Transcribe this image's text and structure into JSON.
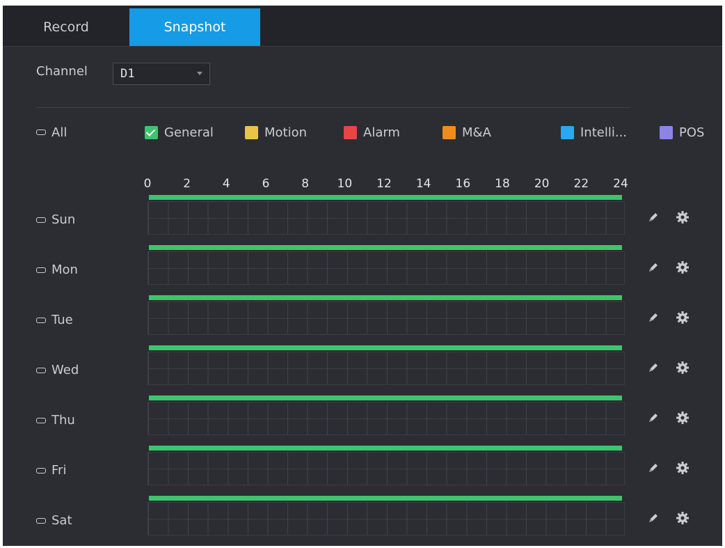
{
  "tabs": [
    {
      "label": "Record",
      "active": false
    },
    {
      "label": "Snapshot",
      "active": true
    }
  ],
  "channel": {
    "label": "Channel",
    "value": "D1"
  },
  "all_label": "All",
  "legend": [
    {
      "label": "General",
      "color": "#3ec46d",
      "checked": true
    },
    {
      "label": "Motion",
      "color": "#e8c547",
      "checked": false
    },
    {
      "label": "Alarm",
      "color": "#e84545",
      "checked": false
    },
    {
      "label": "M&A",
      "color": "#f08c1e",
      "checked": false
    },
    {
      "label": "Intelli...",
      "color": "#2aa7ef",
      "checked": false
    },
    {
      "label": "POS",
      "color": "#8c84e6",
      "checked": false
    }
  ],
  "hours": [
    "0",
    "2",
    "4",
    "6",
    "8",
    "10",
    "12",
    "14",
    "16",
    "18",
    "20",
    "22",
    "24"
  ],
  "days": [
    {
      "label": "Sun",
      "schedule": [
        {
          "type": "General",
          "start": 0,
          "end": 24
        }
      ]
    },
    {
      "label": "Mon",
      "schedule": [
        {
          "type": "General",
          "start": 0,
          "end": 24
        }
      ]
    },
    {
      "label": "Tue",
      "schedule": [
        {
          "type": "General",
          "start": 0,
          "end": 24
        }
      ]
    },
    {
      "label": "Wed",
      "schedule": [
        {
          "type": "General",
          "start": 0,
          "end": 24
        }
      ]
    },
    {
      "label": "Thu",
      "schedule": [
        {
          "type": "General",
          "start": 0,
          "end": 24
        }
      ]
    },
    {
      "label": "Fri",
      "schedule": [
        {
          "type": "General",
          "start": 0,
          "end": 24
        }
      ]
    },
    {
      "label": "Sat",
      "schedule": [
        {
          "type": "General",
          "start": 0,
          "end": 24
        }
      ]
    }
  ],
  "icons": {
    "edit": "pencil-icon",
    "settings": "gear-icon",
    "dropdown": "chevron-down-icon",
    "toggle": "checkbox-icon"
  },
  "colors": {
    "accent": "#169be6",
    "background": "#2b2d33",
    "schedule_bar": "#3ec46d"
  }
}
